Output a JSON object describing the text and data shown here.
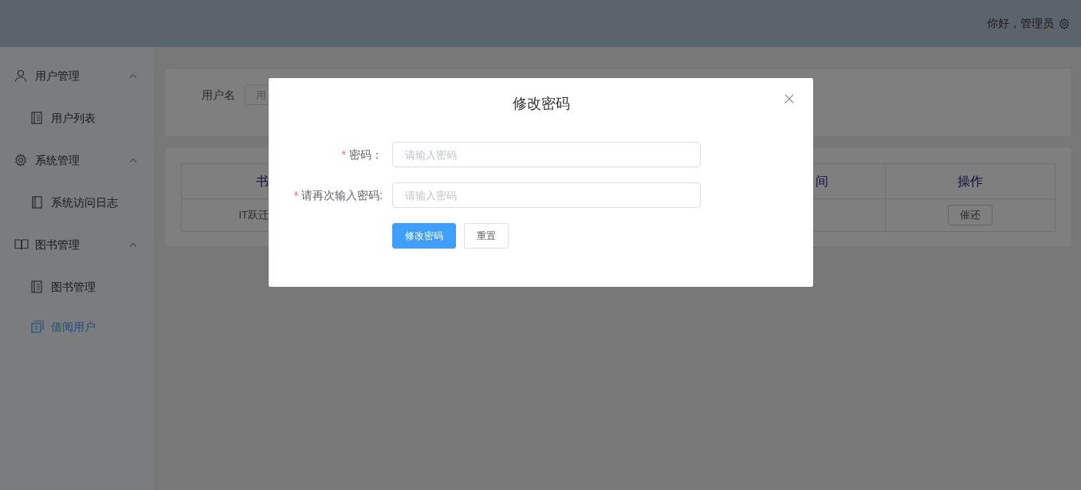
{
  "header": {
    "greeting": "你好，管理员"
  },
  "sidebar": {
    "groups": [
      {
        "label": "用户管理",
        "expanded": true,
        "children": [
          {
            "label": "用户列表",
            "selected": false
          }
        ]
      },
      {
        "label": "系统管理",
        "expanded": true,
        "children": [
          {
            "label": "系统访问日志",
            "selected": false
          }
        ]
      },
      {
        "label": "图书管理",
        "expanded": true,
        "children": [
          {
            "label": "图书管理",
            "selected": false
          },
          {
            "label": "借阅用户",
            "selected": true
          }
        ]
      }
    ]
  },
  "search": {
    "label": "用户名",
    "placeholder": "用"
  },
  "table": {
    "columns": [
      "书",
      "间",
      "操作"
    ],
    "rows": [
      {
        "cells": [
          "IT跃迁",
          ""
        ],
        "action": "催还"
      }
    ]
  },
  "dialog": {
    "title": "修改密码",
    "fields": [
      {
        "label": "密码：",
        "required_mark": "*",
        "placeholder": "请输入密码"
      },
      {
        "label": "请再次输入密码:",
        "required_mark": "*",
        "placeholder": "请输入密码"
      }
    ],
    "buttons": [
      {
        "label": "修改密码",
        "kind": "primary"
      },
      {
        "label": "重置",
        "kind": "default"
      }
    ]
  }
}
